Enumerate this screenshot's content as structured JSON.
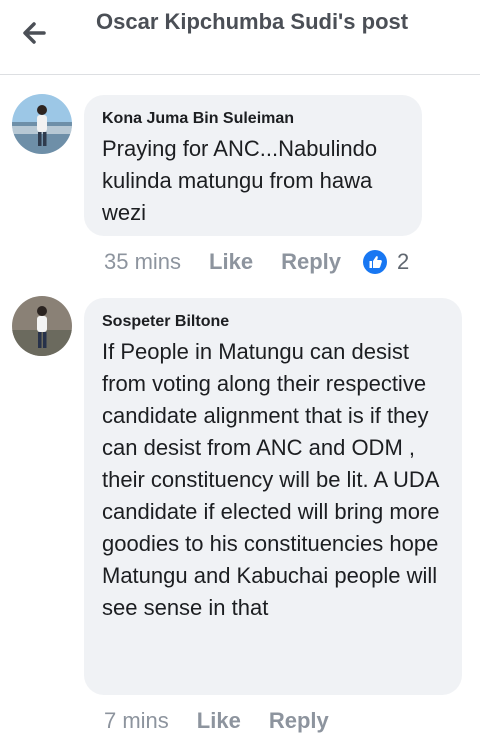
{
  "header": {
    "title": "Oscar Kipchumba Sudi's post",
    "back_icon": "arrow-left-icon"
  },
  "comments": [
    {
      "author": "Kona Juma Bin Suleiman",
      "text": "Praying for ANC...Nabulindo kulinda matungu from hawa wezi",
      "time": "35 mins",
      "like_label": "Like",
      "reply_label": "Reply",
      "reaction_count": "2",
      "reaction_icon": "thumbs-up-icon"
    },
    {
      "author": "Sospeter Biltone",
      "text": "If People in Matungu can desist from voting along their respective candidate alignment that is if they can desist from ANC and ODM , their constituency will be lit. A UDA candidate if elected will bring more goodies to his constituencies hope Matungu and Kabuchai  people will see sense in that",
      "time": "7 mins",
      "like_label": "Like",
      "reply_label": "Reply"
    }
  ],
  "colors": {
    "bubble": "#f0f2f5",
    "meta_text": "#8d949e",
    "like_blue": "#1877f2"
  }
}
